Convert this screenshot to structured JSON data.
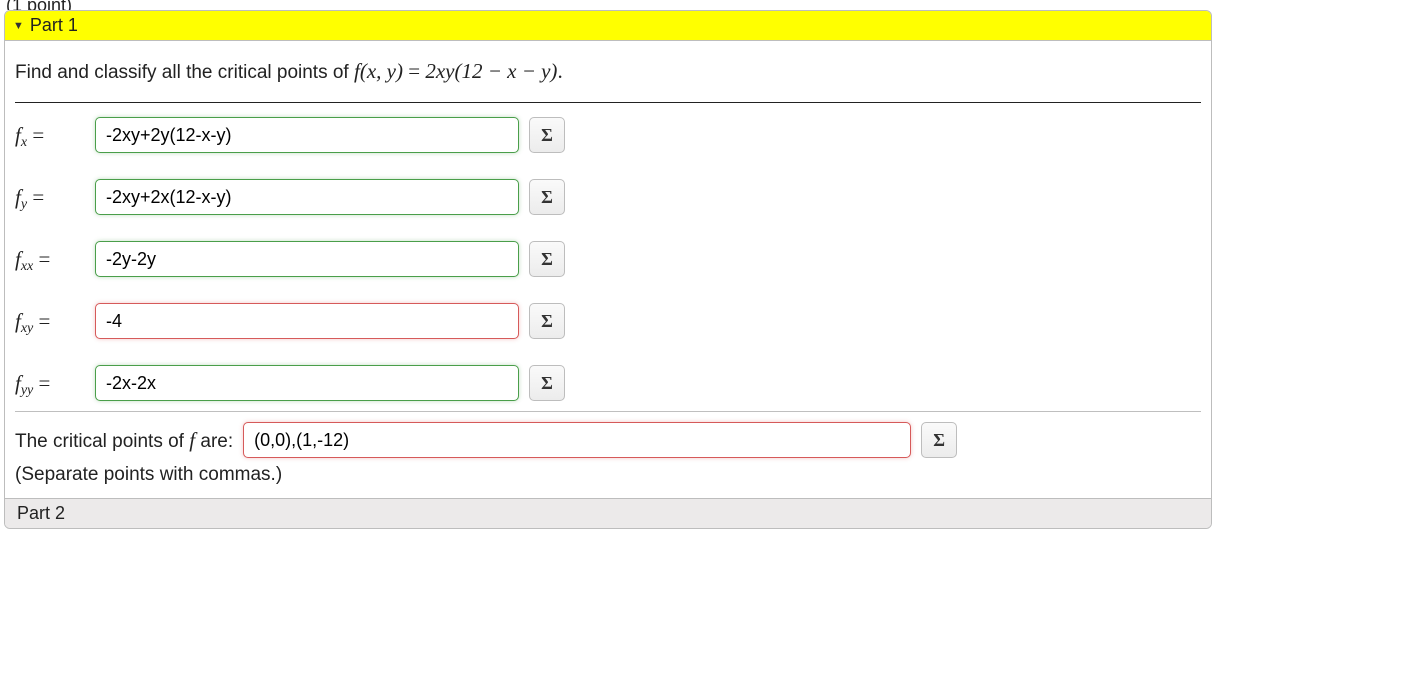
{
  "preheader_fragment": "(1 point)",
  "parts": {
    "part1": {
      "title": "Part 1",
      "open": true
    },
    "part2": {
      "title": "Part 2",
      "open": false
    }
  },
  "prompt": {
    "lead": "Find and classify all the critical points of ",
    "func_lhs": "f(x, y)",
    "equals": " = ",
    "func_rhs": "2xy(12 − x − y)",
    "period": "."
  },
  "labels": {
    "fx": "f",
    "fx_sub": "x",
    "fy": "f",
    "fy_sub": "y",
    "fxx": "f",
    "fxx_sub": "xx",
    "fxy": "f",
    "fxy_sub": "xy",
    "fyy": "f",
    "fyy_sub": "yy",
    "eq": " = "
  },
  "answers": {
    "fx": {
      "value": "-2xy+2y(12-x-y)",
      "status": "correct"
    },
    "fy": {
      "value": "-2xy+2x(12-x-y)",
      "status": "correct"
    },
    "fxx": {
      "value": "-2y-2y",
      "status": "correct"
    },
    "fxy": {
      "value": "-4",
      "status": "incorrect"
    },
    "fyy": {
      "value": "-2x-2x",
      "status": "correct"
    },
    "crit": {
      "value": "(0,0),(1,-12)",
      "status": "incorrect"
    }
  },
  "crit_label_pre": "The critical points of ",
  "crit_label_f": "f",
  "crit_label_post": " are: ",
  "hint": "(Separate points with commas.)",
  "sigma_glyph": "Σ"
}
